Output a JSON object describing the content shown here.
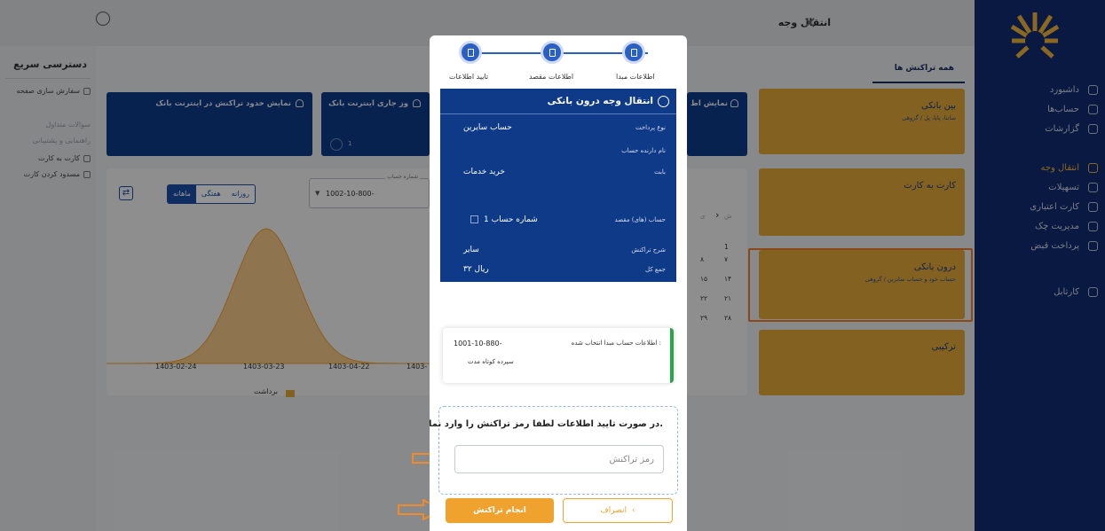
{
  "app": {
    "title": "انتقال وجه"
  },
  "sidebar": {
    "items": [
      {
        "label": "داشبورد",
        "active": false
      },
      {
        "label": "حساب‌ها",
        "active": false
      },
      {
        "label": "گزارشات",
        "active": false
      },
      {
        "label": "انتقال وجه",
        "active": true
      },
      {
        "label": "تسهیلات",
        "active": false
      },
      {
        "label": "کارت اعتباری",
        "active": false
      },
      {
        "label": "مدیریت چک",
        "active": false
      },
      {
        "label": "پرداخت قبض",
        "active": false
      },
      {
        "label": "کارتابل",
        "active": false
      }
    ]
  },
  "quick_access": {
    "title": "دسترسی سریع",
    "items": [
      {
        "label": "سفارش سازی صفحه",
        "muted": false
      },
      {
        "label": "سوالات متداول",
        "muted": true
      },
      {
        "label": "راهنمایی و پشتیبانی",
        "muted": true
      },
      {
        "label": "کارت به کارت",
        "muted": false
      },
      {
        "label": "مسدود کردن کارت",
        "muted": false
      }
    ]
  },
  "tabs": {
    "all_transactions": "همه تراکنش ها"
  },
  "transfer_cards": [
    {
      "title": "بین بانکی",
      "subtitle": "ساتنا، پایا، پل / گروهی"
    },
    {
      "title": "کارت به کارت",
      "subtitle": ""
    },
    {
      "title": "درون بانکی",
      "subtitle": "حساب خود و حساب سایرین / گروهی"
    },
    {
      "title": "ترکیبی",
      "subtitle": ""
    }
  ],
  "info_cards": [
    {
      "title": "نمایش حدود تراکنش در اینترنت بانک"
    },
    {
      "title": "وز جاری اینترنت بانک"
    },
    {
      "title": "نمایش اط"
    }
  ],
  "info_card_count": "1",
  "chart_panel": {
    "account_label": "شماره حساب",
    "account_value": "1002-10-800-",
    "periods": [
      "روزانه",
      "هفتگی",
      "ماهانه"
    ],
    "active_period": "ماهانه",
    "calendar": {
      "header": [
        "ش",
        "ی"
      ],
      "rows": [
        [
          "1",
          ""
        ],
        [
          "۷",
          "۸"
        ],
        [
          "۱۴",
          "۱۵"
        ],
        [
          "۲۱",
          "۲۲"
        ],
        [
          "۲۸",
          "۲۹"
        ]
      ]
    }
  },
  "chart_data": {
    "type": "area",
    "x": [
      "1403-02-24",
      "1403-03-23",
      "1403-04-22",
      "1403-"
    ],
    "series": [
      {
        "name": "برداشت",
        "color": "#f0a22f"
      }
    ],
    "legend": "bottom"
  },
  "modal": {
    "steps": [
      {
        "label": "اطلاعات مبدا",
        "icon": "card-icon"
      },
      {
        "label": "اطلاعات مقصد",
        "icon": "card-plus-icon"
      },
      {
        "label": "تایید اطلاعات",
        "icon": "document-icon"
      }
    ],
    "summary": {
      "title": "انتقال وجه درون بانکی",
      "rows": [
        {
          "label": "نوع پرداخت",
          "value": "حساب سایرین"
        },
        {
          "label": "نام دارنده حساب",
          "value": ""
        },
        {
          "label": "بابت",
          "value": "خرید خدمات"
        },
        {
          "label": "حساب (های) مقصد",
          "value": "1 شماره حساب"
        },
        {
          "label": "شرح تراکنش",
          "value": "سایر"
        },
        {
          "label": "جمع کل",
          "value": "۳۲ ریال"
        }
      ]
    },
    "source": {
      "label": "اطلاعات حساب مبدا انتخاب شده :",
      "account": "1001-10-880-",
      "type": "سپرده کوتاه مدت"
    },
    "password": {
      "message": "در صورت تایید اطلاعات لطفا رمز تراکنش را وارد نمایید.",
      "placeholder": "رمز تراکنش"
    },
    "buttons": {
      "confirm": "انجام تراکنش",
      "cancel": "انصراف"
    }
  },
  "colors": {
    "navy": "#102b72",
    "gold": "#e0a83a",
    "orange": "#f0a22f",
    "blue": "#0e3a88",
    "green": "#26a54d"
  }
}
